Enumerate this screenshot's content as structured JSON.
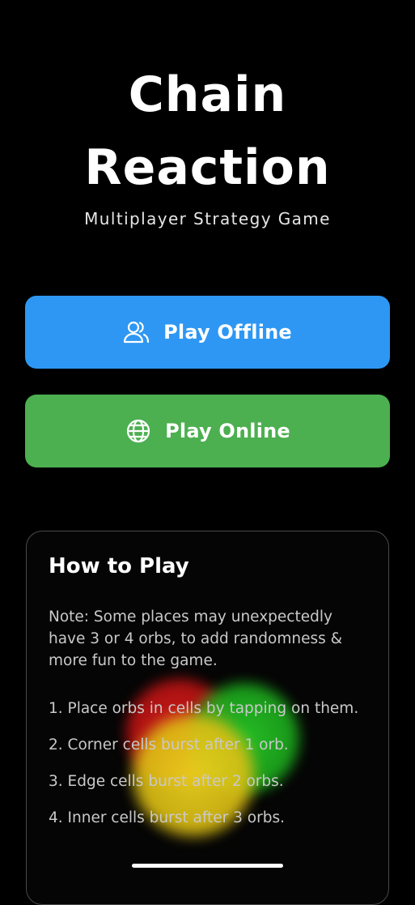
{
  "app": {
    "title_line1": "Chain",
    "title_line2": "Reaction",
    "subtitle": "Multiplayer Strategy Game"
  },
  "buttons": {
    "offline": {
      "label": "Play Offline",
      "icon": "users-icon",
      "color": "#2e97f3"
    },
    "online": {
      "label": "Play Online",
      "icon": "globe-icon",
      "color": "#4caf50"
    }
  },
  "how_to_play": {
    "title": "How to Play",
    "note": "Note: Some places may unexpectedly have 3 or 4 orbs, to add randomness & more fun to the game.",
    "steps": [
      "1. Place orbs in cells by tapping on them.",
      "2. Corner cells burst after 1 orb.",
      "3. Edge cells burst after 2 orbs.",
      "4. Inner cells burst after 3 orbs."
    ],
    "orb_colors": [
      "#dc1e1e",
      "#28c828",
      "#ebd21e"
    ]
  }
}
